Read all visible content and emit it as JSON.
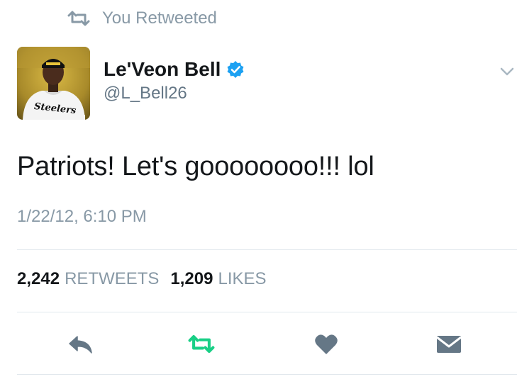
{
  "context": {
    "label": "You Retweeted",
    "icon": "retweet-icon"
  },
  "author": {
    "display_name": "Le'Veon Bell",
    "handle": "@L_Bell26",
    "verified": true,
    "avatar_jersey_text": "Steelers"
  },
  "tweet": {
    "text": "Patriots! Let's goooooooo!!! lol",
    "timestamp": "1/22/12, 6:10 PM"
  },
  "stats": {
    "retweets_count": "2,242",
    "retweets_label": "RETWEETS",
    "likes_count": "1,209",
    "likes_label": "LIKES"
  },
  "actions": [
    {
      "name": "reply",
      "icon": "reply-icon"
    },
    {
      "name": "retweet",
      "icon": "retweet-icon",
      "active": true
    },
    {
      "name": "like",
      "icon": "heart-icon"
    },
    {
      "name": "message",
      "icon": "envelope-icon"
    }
  ],
  "colors": {
    "retweet_active": "#19cf86",
    "icon_default": "#657786",
    "verified_blue": "#1da1f2",
    "secondary_text": "#8899a6"
  }
}
